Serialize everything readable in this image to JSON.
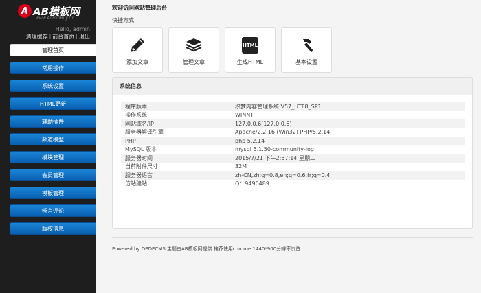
{
  "brand": {
    "badge": "A",
    "name": "AB模板网",
    "sub": "www.AdminBuy.Cn"
  },
  "user": {
    "greeting": "Hello, admin",
    "links": [
      "清理缓存",
      "前台首页",
      "退出"
    ]
  },
  "menu": [
    {
      "label": "管理首页",
      "active": true
    },
    {
      "label": "常用操作"
    },
    {
      "label": "系统设置"
    },
    {
      "label": "HTML更新"
    },
    {
      "label": "辅助插件"
    },
    {
      "label": "频道模型"
    },
    {
      "label": "模块管理"
    },
    {
      "label": "会员管理"
    },
    {
      "label": "模板管理"
    },
    {
      "label": "畅言评论"
    },
    {
      "label": "版权信息"
    }
  ],
  "main": {
    "welcome": "欢迎访问网站管理后台",
    "quick_label": "快捷方式",
    "tiles": [
      {
        "label": "添加文章",
        "icon": "pencil-icon"
      },
      {
        "label": "管理文章",
        "icon": "stack-icon"
      },
      {
        "label": "生成HTML",
        "icon": "html-icon",
        "icon_text": "HTML"
      },
      {
        "label": "基本设置",
        "icon": "hammer-icon"
      }
    ],
    "panel_title": "系统信息",
    "info": [
      {
        "key": "程序版本",
        "value": "织梦内容管理系统 V57_UTF8_SP1"
      },
      {
        "key": "操作系统",
        "value": "WINNT"
      },
      {
        "key": "网站域名/IP",
        "value": "127.0.0.6(127.0.0.6)"
      },
      {
        "key": "服务器解译引擎",
        "value": "Apache/2.2.16 (Win32) PHP/5.2.14"
      },
      {
        "key": "PHP",
        "value": "php 5.2.14"
      },
      {
        "key": "MySQL 版本",
        "value": "mysql 5.1.50-community-log"
      },
      {
        "key": "服务器时间",
        "value": "2015/7/21 下午2:57:14 星期二"
      },
      {
        "key": "当前附件尺寸",
        "value": "32M"
      },
      {
        "key": "服务器语言",
        "value": "zh-CN,zh;q=0.8,en;q=0.6,fr;q=0.4"
      },
      {
        "key": "仿站建站",
        "value": "Q：9490489"
      }
    ],
    "footer": "Powered by DEDECMS 主题由AB模板网提供 推荐使用chrome 1440*900分辨率浏览"
  }
}
